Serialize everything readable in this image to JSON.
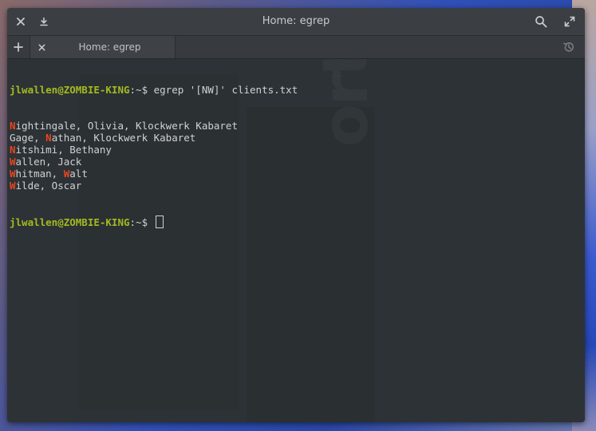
{
  "window": {
    "title": "Home: egrep"
  },
  "tabs": [
    {
      "label": "Home: egrep"
    }
  ],
  "terminal": {
    "prompt_user": "jlwallen@ZOMBIE-KING",
    "prompt_path": ":~$",
    "command": " egrep '[NW]' clients.txt",
    "results": [
      {
        "segments": [
          {
            "t": "N",
            "hl": true
          },
          {
            "t": "ightingale, Olivia, Klockwerk Kabaret",
            "hl": false
          }
        ]
      },
      {
        "segments": [
          {
            "t": "Gage, ",
            "hl": false
          },
          {
            "t": "N",
            "hl": true
          },
          {
            "t": "athan, Klockwerk Kabaret",
            "hl": false
          }
        ]
      },
      {
        "segments": [
          {
            "t": "N",
            "hl": true
          },
          {
            "t": "itshimi, Bethany",
            "hl": false
          }
        ]
      },
      {
        "segments": [
          {
            "t": "W",
            "hl": true
          },
          {
            "t": "allen, Jack",
            "hl": false
          }
        ]
      },
      {
        "segments": [
          {
            "t": "W",
            "hl": true
          },
          {
            "t": "hitman, ",
            "hl": false
          },
          {
            "t": "W",
            "hl": true
          },
          {
            "t": "alt",
            "hl": false
          }
        ]
      },
      {
        "segments": [
          {
            "t": "W",
            "hl": true
          },
          {
            "t": "ilde, Oscar",
            "hl": false
          }
        ]
      }
    ],
    "watermark": "ortofon"
  },
  "colors": {
    "prompt": "#a3ba1f",
    "match": "#e8471e",
    "text": "#d0d2d3",
    "background": "#2d3236"
  },
  "icons": {
    "close": "close-icon",
    "download": "download-icon",
    "search": "search-icon",
    "fullscreen": "fullscreen-icon",
    "new_tab": "plus-icon",
    "tab_close": "close-icon",
    "history": "history-icon"
  }
}
